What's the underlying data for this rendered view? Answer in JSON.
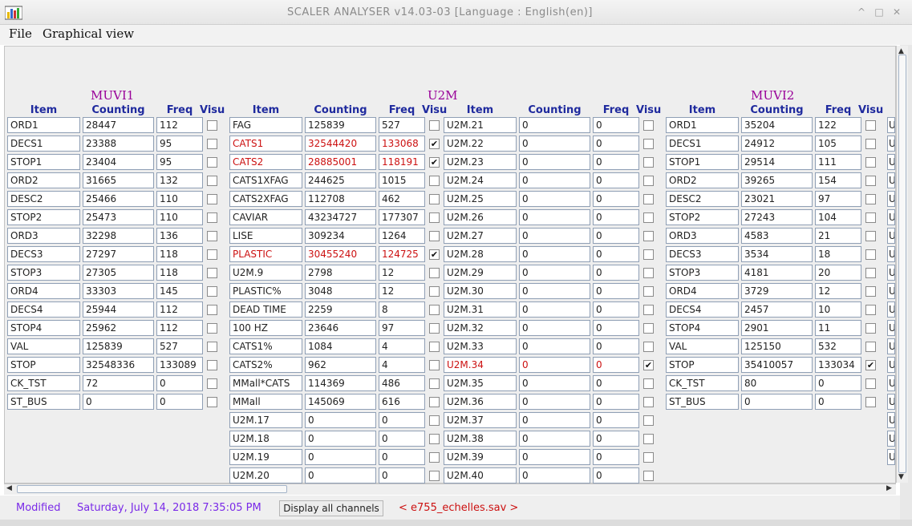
{
  "window": {
    "title": "SCALER ANALYSER v14.03-03 [Language : English(en)]",
    "controls": {
      "minimize": "^",
      "maximize": "□",
      "close": "✕"
    }
  },
  "menu": [
    "File",
    "Graphical view"
  ],
  "headers": {
    "item": "Item",
    "counting": "Counting",
    "freq": "Freq",
    "visu": "Visu"
  },
  "groups": {
    "muvi1": {
      "title": "MUVI1",
      "rows": [
        [
          "ORD1",
          "28447",
          "112",
          false,
          false
        ],
        [
          "DECS1",
          "23388",
          "95",
          false,
          false
        ],
        [
          "STOP1",
          "23404",
          "95",
          false,
          false
        ],
        [
          "ORD2",
          "31665",
          "132",
          false,
          false
        ],
        [
          "DESC2",
          "25466",
          "110",
          false,
          false
        ],
        [
          "STOP2",
          "25473",
          "110",
          false,
          false
        ],
        [
          "ORD3",
          "32298",
          "136",
          false,
          false
        ],
        [
          "DECS3",
          "27297",
          "118",
          false,
          false
        ],
        [
          "STOP3",
          "27305",
          "118",
          false,
          false
        ],
        [
          "ORD4",
          "33303",
          "145",
          false,
          false
        ],
        [
          "DECS4",
          "25944",
          "112",
          false,
          false
        ],
        [
          "STOP4",
          "25962",
          "112",
          false,
          false
        ],
        [
          "VAL",
          "125839",
          "527",
          false,
          false
        ],
        [
          "STOP",
          "32548336",
          "133089",
          false,
          false
        ],
        [
          "CK_TST",
          "72",
          "0",
          false,
          false
        ],
        [
          "ST_BUS",
          "0",
          "0",
          false,
          false
        ]
      ]
    },
    "u2m_a": {
      "title": "U2M",
      "rows": [
        [
          "FAG",
          "125839",
          "527",
          false,
          false
        ],
        [
          "CATS1",
          "32544420",
          "133068",
          true,
          true
        ],
        [
          "CATS2",
          "28885001",
          "118191",
          true,
          true
        ],
        [
          "CATS1XFAG",
          "244625",
          "1015",
          false,
          false
        ],
        [
          "CATS2XFAG",
          "112708",
          "462",
          false,
          false
        ],
        [
          "CAVIAR",
          "43234727",
          "177307",
          false,
          false
        ],
        [
          "LISE",
          "309234",
          "1264",
          false,
          false
        ],
        [
          "PLASTIC",
          "30455240",
          "124725",
          true,
          true
        ],
        [
          "U2M.9",
          "2798",
          "12",
          false,
          false
        ],
        [
          "PLASTIC%",
          "3048",
          "12",
          false,
          false
        ],
        [
          "DEAD TIME",
          "2259",
          "8",
          false,
          false
        ],
        [
          "100 HZ",
          "23646",
          "97",
          false,
          false
        ],
        [
          "CATS1%",
          "1084",
          "4",
          false,
          false
        ],
        [
          "CATS2%",
          "962",
          "4",
          false,
          false
        ],
        [
          "MMall*CATS",
          "114369",
          "486",
          false,
          false
        ],
        [
          "MMall",
          "145069",
          "616",
          false,
          false
        ],
        [
          "U2M.17",
          "0",
          "0",
          false,
          false
        ],
        [
          "U2M.18",
          "0",
          "0",
          false,
          false
        ],
        [
          "U2M.19",
          "0",
          "0",
          false,
          false
        ],
        [
          "U2M.20",
          "0",
          "0",
          false,
          false
        ]
      ]
    },
    "u2m_b": {
      "rows": [
        [
          "U2M.21",
          "0",
          "0",
          false,
          false
        ],
        [
          "U2M.22",
          "0",
          "0",
          false,
          false
        ],
        [
          "U2M.23",
          "0",
          "0",
          false,
          false
        ],
        [
          "U2M.24",
          "0",
          "0",
          false,
          false
        ],
        [
          "U2M.25",
          "0",
          "0",
          false,
          false
        ],
        [
          "U2M.26",
          "0",
          "0",
          false,
          false
        ],
        [
          "U2M.27",
          "0",
          "0",
          false,
          false
        ],
        [
          "U2M.28",
          "0",
          "0",
          false,
          false
        ],
        [
          "U2M.29",
          "0",
          "0",
          false,
          false
        ],
        [
          "U2M.30",
          "0",
          "0",
          false,
          false
        ],
        [
          "U2M.31",
          "0",
          "0",
          false,
          false
        ],
        [
          "U2M.32",
          "0",
          "0",
          false,
          false
        ],
        [
          "U2M.33",
          "0",
          "0",
          false,
          false
        ],
        [
          "U2M.34",
          "0",
          "0",
          true,
          true
        ],
        [
          "U2M.35",
          "0",
          "0",
          false,
          false
        ],
        [
          "U2M.36",
          "0",
          "0",
          false,
          false
        ],
        [
          "U2M.37",
          "0",
          "0",
          false,
          false
        ],
        [
          "U2M.38",
          "0",
          "0",
          false,
          false
        ],
        [
          "U2M.39",
          "0",
          "0",
          false,
          false
        ],
        [
          "U2M.40",
          "0",
          "0",
          false,
          false
        ]
      ]
    },
    "muvi2": {
      "title": "MUVI2",
      "rows": [
        [
          "ORD1",
          "35204",
          "122",
          false,
          false
        ],
        [
          "DECS1",
          "24912",
          "105",
          false,
          false
        ],
        [
          "STOP1",
          "29514",
          "111",
          false,
          false
        ],
        [
          "ORD2",
          "39265",
          "154",
          false,
          false
        ],
        [
          "DESC2",
          "23021",
          "97",
          false,
          false
        ],
        [
          "STOP2",
          "27243",
          "104",
          false,
          false
        ],
        [
          "ORD3",
          "4583",
          "21",
          false,
          false
        ],
        [
          "DECS3",
          "3534",
          "18",
          false,
          false
        ],
        [
          "STOP3",
          "4181",
          "20",
          false,
          false
        ],
        [
          "ORD4",
          "3729",
          "12",
          false,
          false
        ],
        [
          "DECS4",
          "2457",
          "10",
          false,
          false
        ],
        [
          "STOP4",
          "2901",
          "11",
          false,
          false
        ],
        [
          "VAL",
          "125150",
          "532",
          false,
          false
        ],
        [
          "STOP",
          "35410057",
          "133034",
          true,
          false
        ],
        [
          "CK_TST",
          "80",
          "0",
          false,
          false
        ],
        [
          "ST_BUS",
          "0",
          "0",
          false,
          false
        ]
      ]
    },
    "next_column_partial": [
      "U",
      "U",
      "U",
      "U",
      "U",
      "U",
      "U",
      "U",
      "U",
      "U",
      "U",
      "U",
      "U",
      "U",
      "U",
      "U",
      "U",
      "U",
      "U",
      "U"
    ]
  },
  "status": {
    "modified": "Modified",
    "date": "Saturday, July 14, 2018 7:35:05 PM",
    "display_all_button": "Display all channels",
    "file": "< e755_echelles.sav >"
  },
  "colors": {
    "group_title": "#990099",
    "header": "#1f2a9e",
    "highlight_red": "#cc1111",
    "status_purple": "#7a2ae8"
  }
}
